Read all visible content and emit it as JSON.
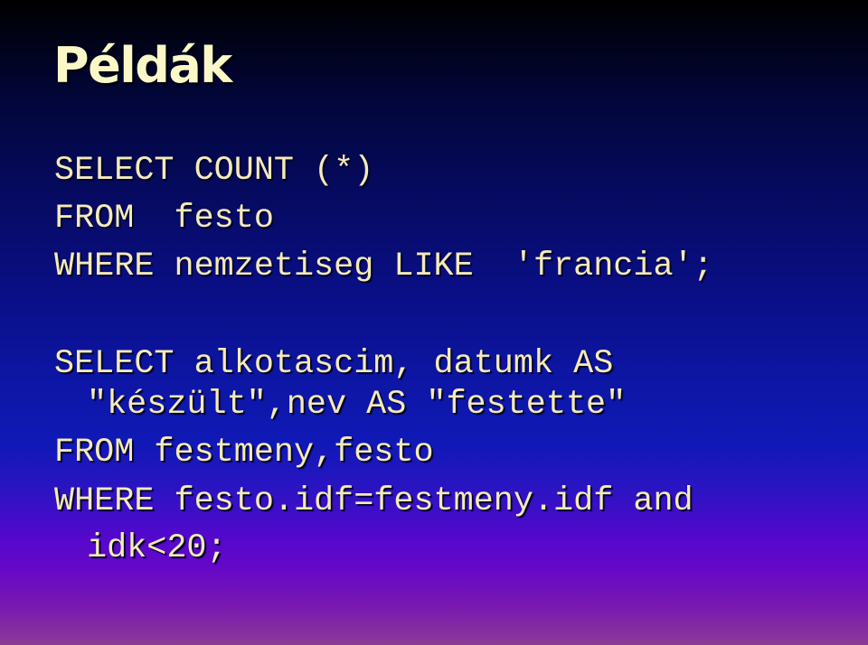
{
  "slide": {
    "title": "Példák",
    "colors": {
      "title_text": "#fbf8c8",
      "code_text": "#f4eab8",
      "background_top": "#000000",
      "background_mid": "#1019b6",
      "background_bottom": "#8c3a98"
    }
  },
  "examples": [
    {
      "lines": [
        "SELECT COUNT (*)",
        "FROM  festo",
        "WHERE nemzetiseg LIKE  'francia';"
      ]
    },
    {
      "lines": [
        "SELECT alkotascim, datumk AS",
        "\"készült\",nev AS \"festette\"",
        "FROM festmeny,festo",
        "WHERE festo.idf=festmeny.idf and",
        "idk<20;"
      ]
    }
  ]
}
